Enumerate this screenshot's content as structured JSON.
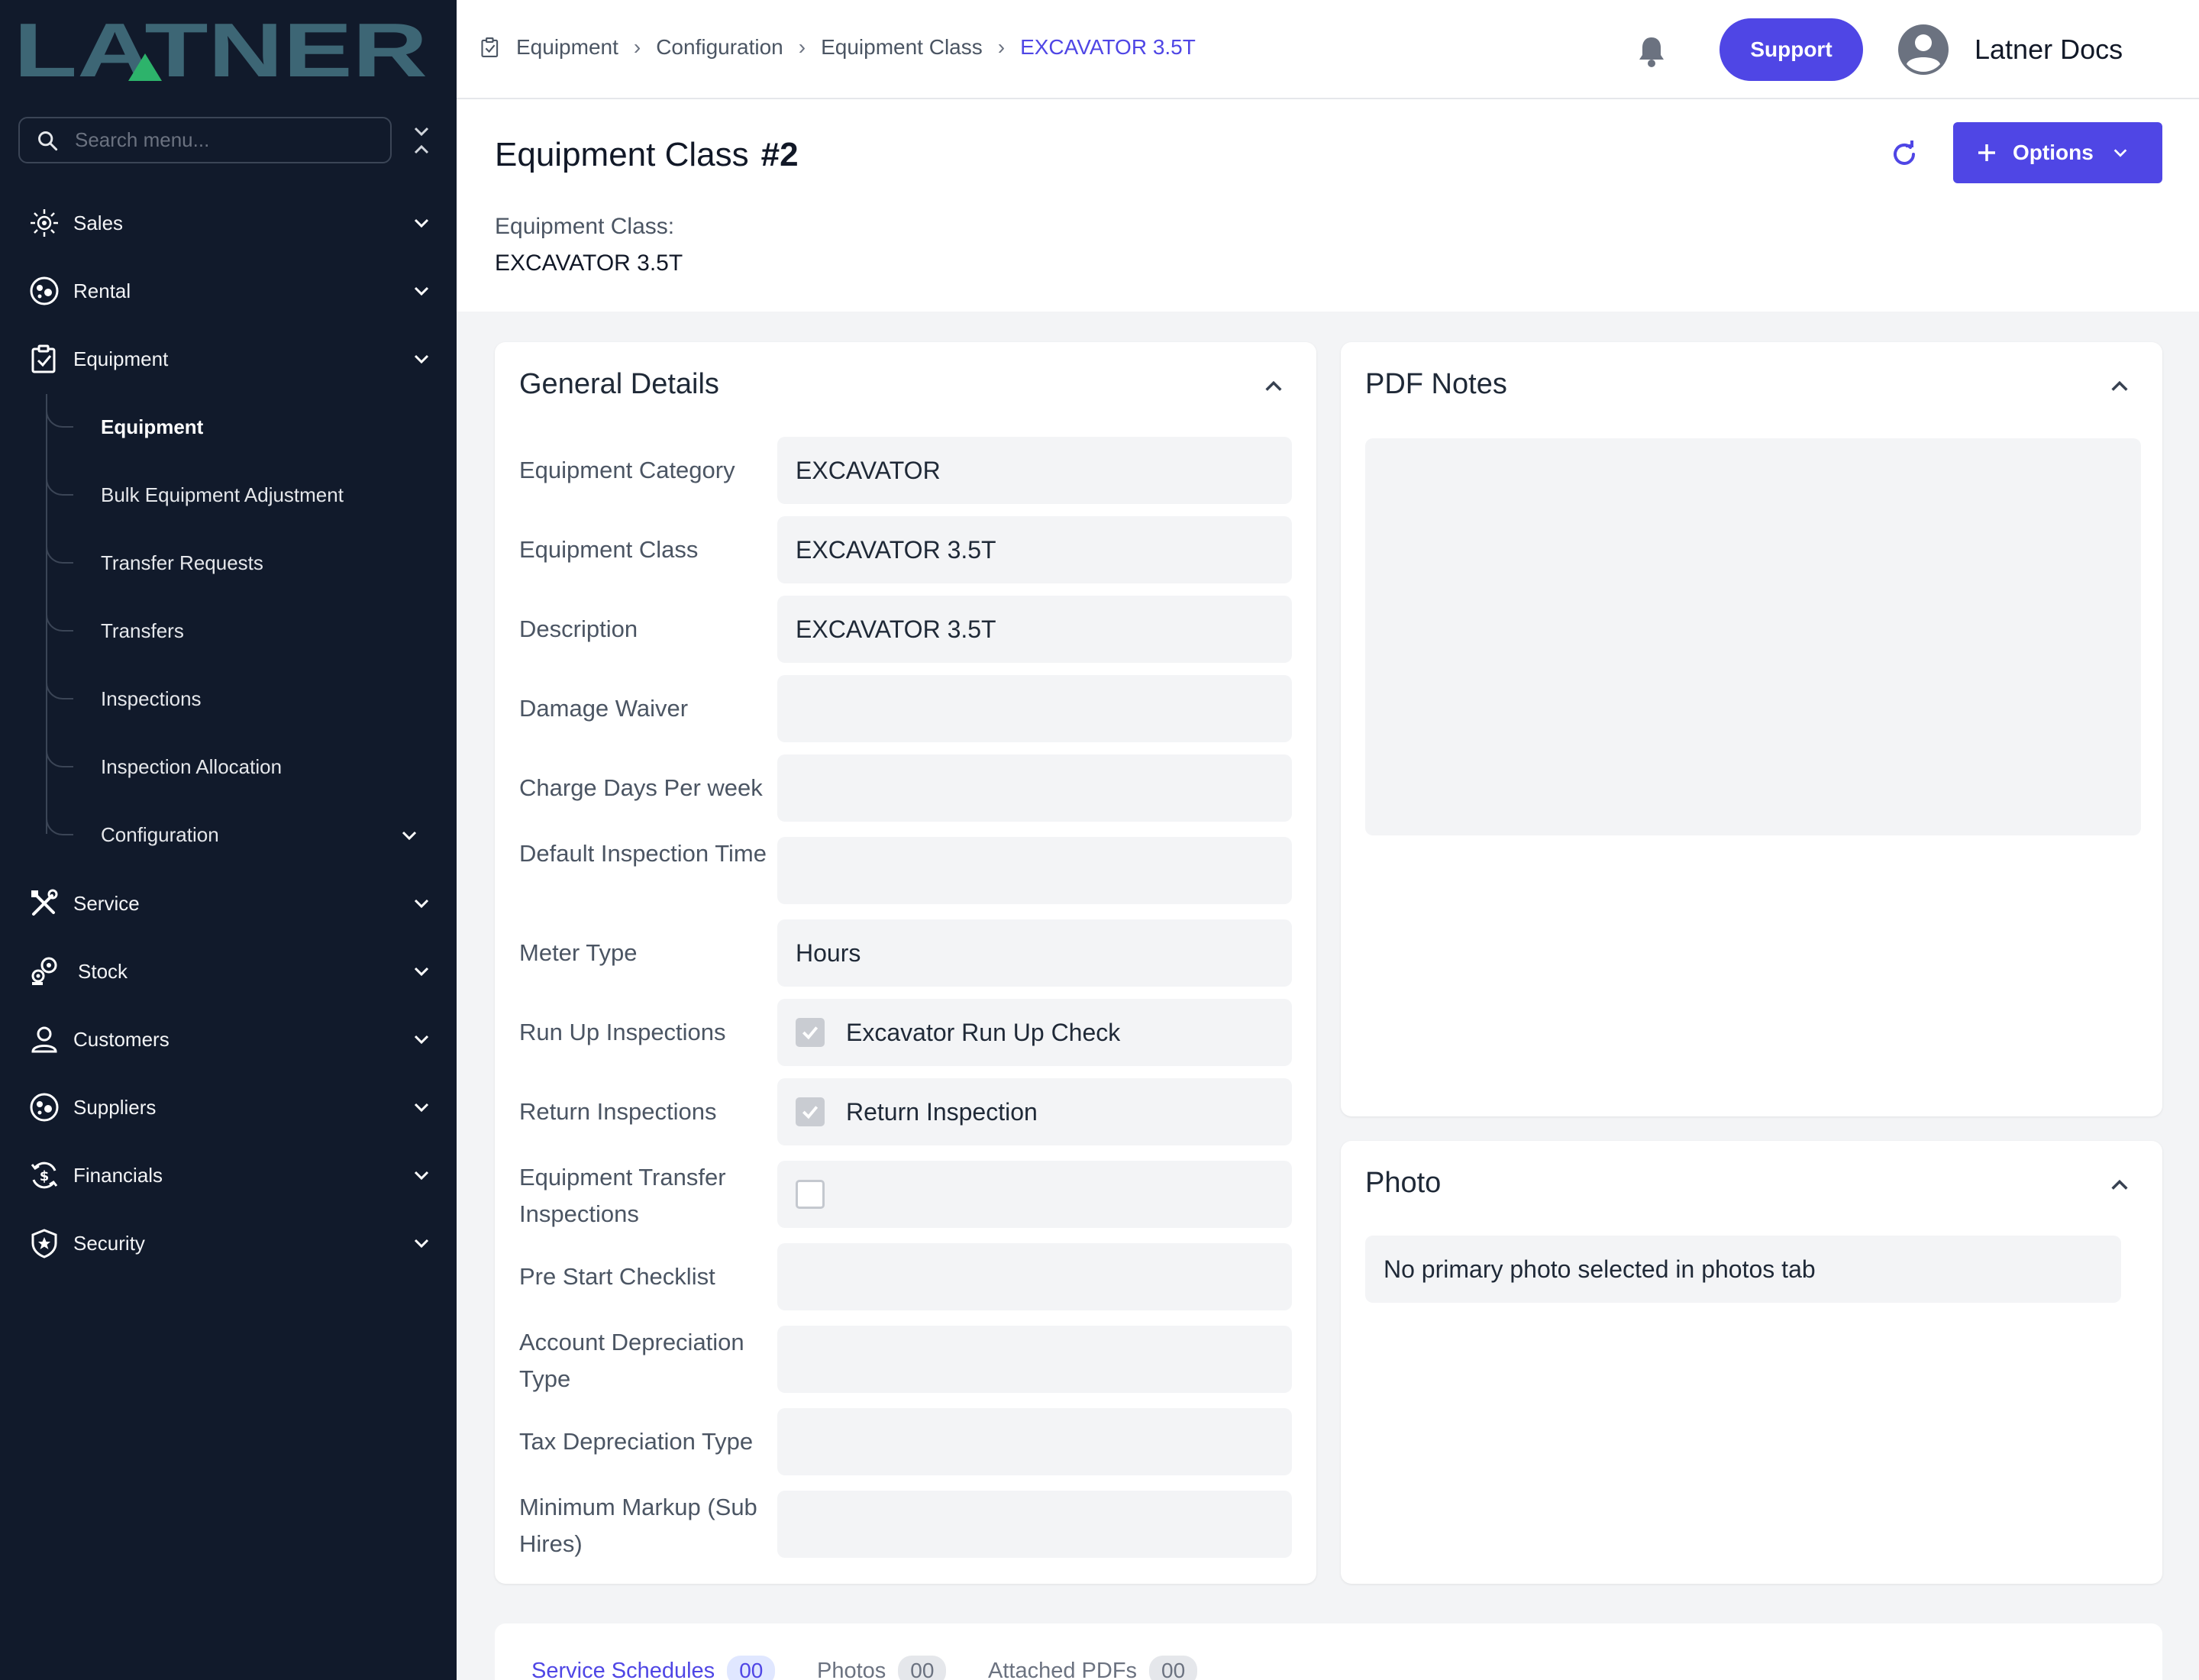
{
  "app": {
    "logo_text": "LATNER"
  },
  "sidebar": {
    "search_placeholder": "Search menu...",
    "items": [
      {
        "label": "Sales",
        "icon": "sales-icon"
      },
      {
        "label": "Rental",
        "icon": "rental-icon"
      },
      {
        "label": "Equipment",
        "icon": "equipment-icon"
      },
      {
        "label": "Service",
        "icon": "service-icon"
      },
      {
        "label": "Stock",
        "icon": "stock-icon"
      },
      {
        "label": "Customers",
        "icon": "customers-icon"
      },
      {
        "label": "Suppliers",
        "icon": "suppliers-icon"
      },
      {
        "label": "Financials",
        "icon": "financials-icon"
      },
      {
        "label": "Security",
        "icon": "security-icon"
      }
    ],
    "equipment_sub": [
      {
        "label": "Equipment",
        "active": true
      },
      {
        "label": "Bulk Equipment Adjustment"
      },
      {
        "label": "Transfer Requests"
      },
      {
        "label": "Transfers"
      },
      {
        "label": "Inspections"
      },
      {
        "label": "Inspection Allocation"
      },
      {
        "label": "Configuration"
      }
    ]
  },
  "topbar": {
    "breadcrumbs": [
      "Equipment",
      "Configuration",
      "Equipment Class",
      "EXCAVATOR 3.5T"
    ],
    "support_label": "Support",
    "user_name": "Latner Docs"
  },
  "header": {
    "title": "Equipment Class",
    "record_no": "#2",
    "options_label": "Options",
    "sub_label": "Equipment Class:",
    "sub_value": "EXCAVATOR 3.5T"
  },
  "general": {
    "title": "General Details",
    "fields": [
      {
        "label": "Equipment Category",
        "value": "EXCAVATOR"
      },
      {
        "label": "Equipment Class",
        "value": "EXCAVATOR 3.5T"
      },
      {
        "label": "Description",
        "value": "EXCAVATOR 3.5T"
      },
      {
        "label": "Damage Waiver",
        "value": ""
      },
      {
        "label": "Charge Days Per week",
        "value": ""
      },
      {
        "label": "Default Inspection Time",
        "value": ""
      },
      {
        "label": "Meter Type",
        "value": "Hours"
      },
      {
        "label": "Run Up Inspections",
        "value": "Excavator Run Up Check",
        "checked": true
      },
      {
        "label": "Return Inspections",
        "value": "Return Inspection",
        "checked": true
      },
      {
        "label": "Equipment Transfer Inspections",
        "value": "",
        "checked": false
      },
      {
        "label": "Pre Start Checklist",
        "value": ""
      },
      {
        "label": "Account Depreciation Type",
        "value": ""
      },
      {
        "label": "Tax Depreciation Type",
        "value": ""
      },
      {
        "label": "Minimum Markup (Sub Hires)",
        "value": ""
      }
    ]
  },
  "pdf_notes": {
    "title": "PDF Notes"
  },
  "photo": {
    "title": "Photo",
    "message": "No primary photo selected in photos tab"
  },
  "tabs": [
    {
      "label": "Service Schedules",
      "count": "00"
    },
    {
      "label": "Photos",
      "count": "00"
    },
    {
      "label": "Attached PDFs",
      "count": "00"
    }
  ],
  "colors": {
    "accent": "#4f46e5",
    "sidebar_bg": "#111a2b",
    "logo": "#3d6675",
    "logo_triangle": "#2db36b"
  }
}
